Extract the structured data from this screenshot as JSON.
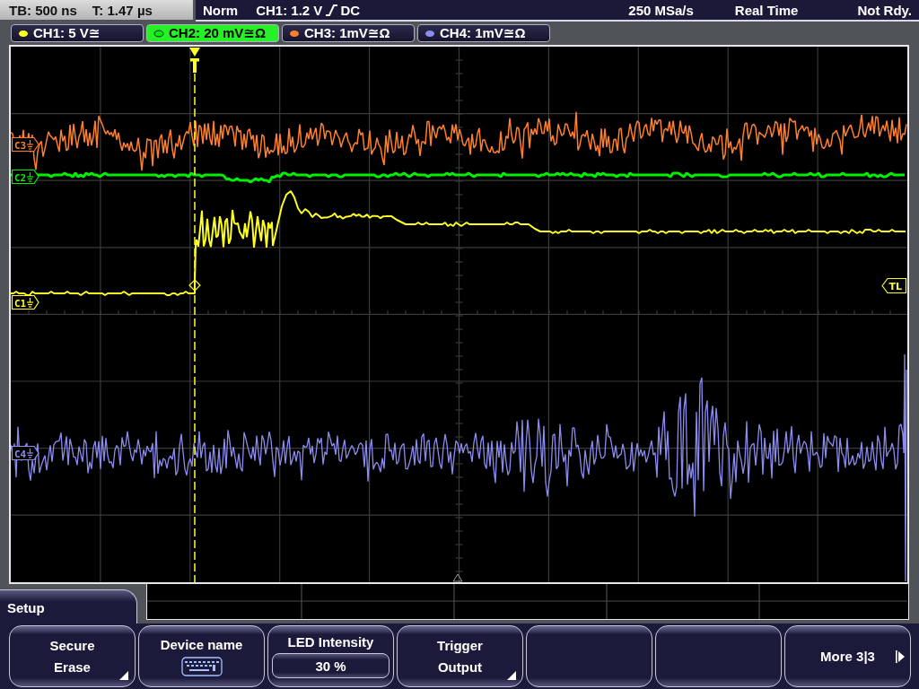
{
  "status_bar": {
    "timebase": "TB: 500 ns",
    "trigger_time": "T: 1.47 µs",
    "trigger_mode": "Norm",
    "trigger_source": "CH1: 1.2 V",
    "trigger_coupling": "DC",
    "sample_rate": "250 MSa/s",
    "acquisition_mode": "Real Time",
    "acquisition_state": "Not Rdy."
  },
  "channels": [
    {
      "label": "CH1: 5 V≅",
      "color": "#ffff22",
      "selected": false
    },
    {
      "label": "CH2: 20 mV≅Ω",
      "color": "#00ee00",
      "selected": true
    },
    {
      "label": "CH3: 1mV≅Ω",
      "color": "#ff7f2a",
      "selected": false
    },
    {
      "label": "CH4: 1mV≅Ω",
      "color": "#8c8cf0",
      "selected": false
    }
  ],
  "channel_markers": [
    {
      "label": "C3",
      "color": "#ff7f2a"
    },
    {
      "label": "C2",
      "color": "#00ee00"
    },
    {
      "label": "C1",
      "color": "#ffff22"
    },
    {
      "label": "C4",
      "color": "#8c8cf0"
    }
  ],
  "trigger_level_marker": "TL",
  "menu": {
    "title": "Setup",
    "softkeys": [
      {
        "kind": "submenu",
        "label": "Secure Erase"
      },
      {
        "kind": "keyboard",
        "label": "Device name"
      },
      {
        "kind": "value",
        "label": "LED Intensity",
        "value": "30 %"
      },
      {
        "kind": "submenu",
        "label": "Trigger Output"
      },
      {
        "kind": "empty"
      },
      {
        "kind": "empty"
      },
      {
        "kind": "next",
        "label": "More 3|3"
      }
    ]
  }
}
